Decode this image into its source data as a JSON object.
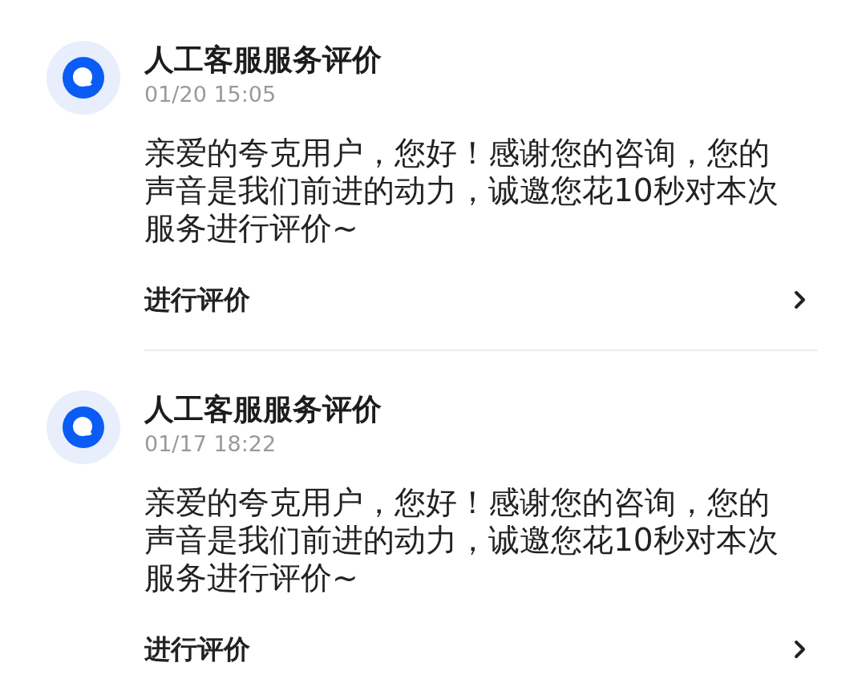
{
  "messages": [
    {
      "title": "人工客服服务评价",
      "time": "01/20 15:05",
      "body": "亲爱的夸克用户，您好！感谢您的咨询，您的声音是我们前进的动力，诚邀您花10秒对本次服务进行评价~",
      "action": "进行评价"
    },
    {
      "title": "人工客服服务评价",
      "time": "01/17 18:22",
      "body": "亲爱的夸克用户，您好！感谢您的咨询，您的声音是我们前进的动力，诚邀您花10秒对本次服务进行评价~",
      "action": "进行评价"
    }
  ]
}
